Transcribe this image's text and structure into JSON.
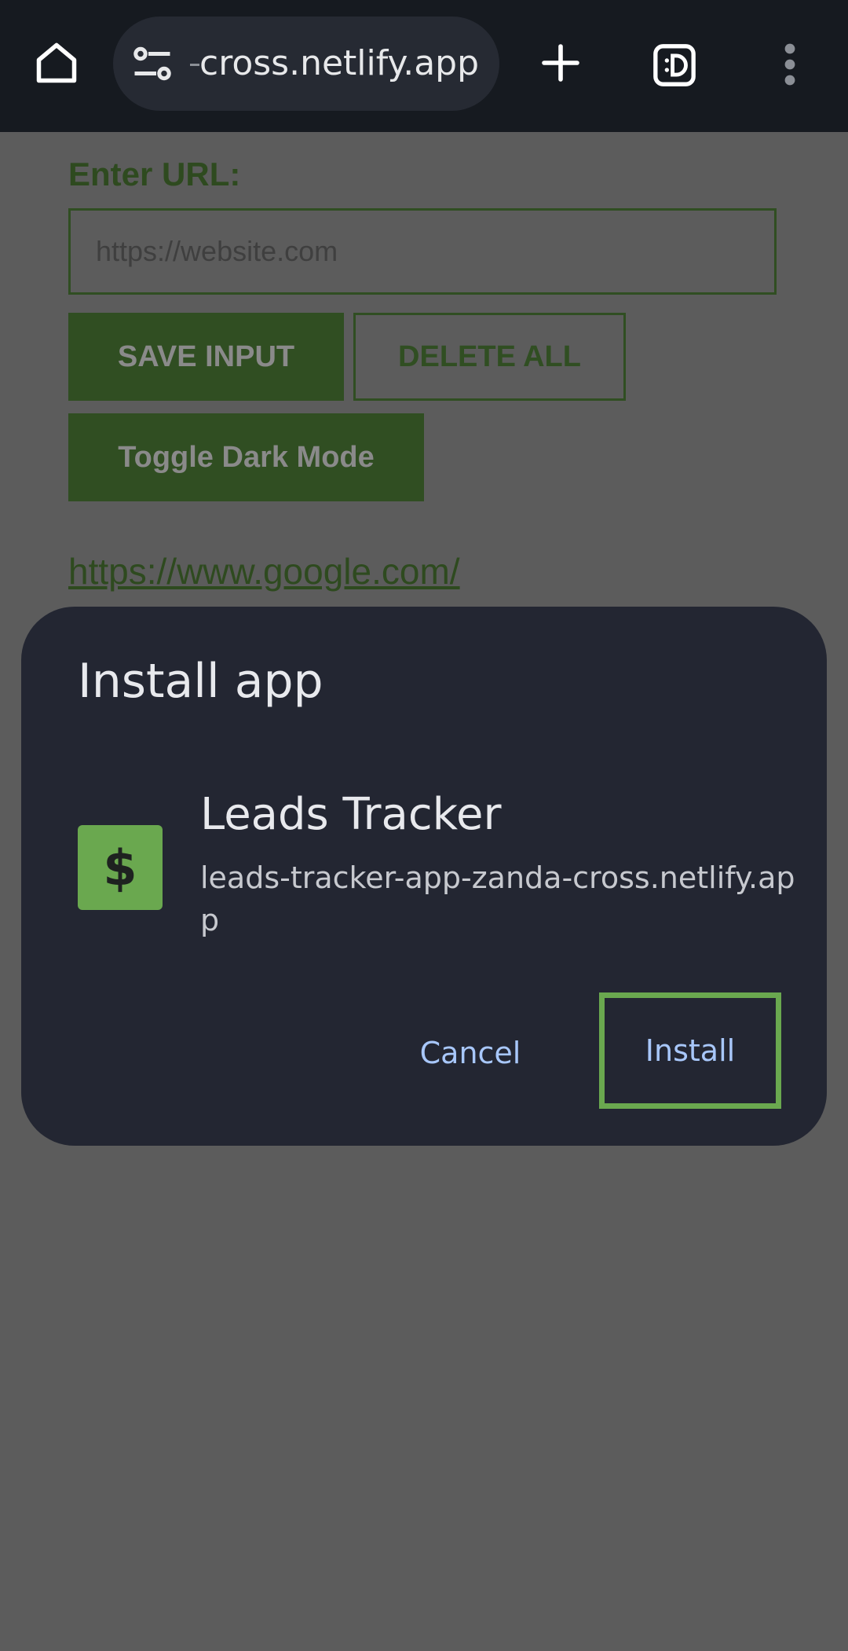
{
  "browser": {
    "url_display": "cross.netlify.app",
    "icons": [
      "home-icon",
      "site-settings-icon",
      "new-tab-icon",
      "tab-switcher-icon",
      "overflow-menu-icon"
    ]
  },
  "page": {
    "label": "Enter URL:",
    "input_placeholder": "https://website.com",
    "input_value": "",
    "save_button": "SAVE INPUT",
    "delete_button": "DELETE ALL",
    "dark_mode_button": "Toggle Dark Mode",
    "links": [
      "https://www.google.com/"
    ]
  },
  "dialog": {
    "title": "Install app",
    "app_icon_glyph": "$",
    "app_name": "Leads Tracker",
    "app_url": "leads-tracker-app-zanda-cross.netlify.app",
    "cancel_label": "Cancel",
    "install_label": "Install"
  },
  "colors": {
    "toolbar": "#161a20",
    "dim_overlay": "#5c5c5c",
    "page_accent": "#304e22",
    "dialog_bg": "#232632",
    "dialog_button_text": "#a8c7fa",
    "highlight": "#6aa84f"
  }
}
